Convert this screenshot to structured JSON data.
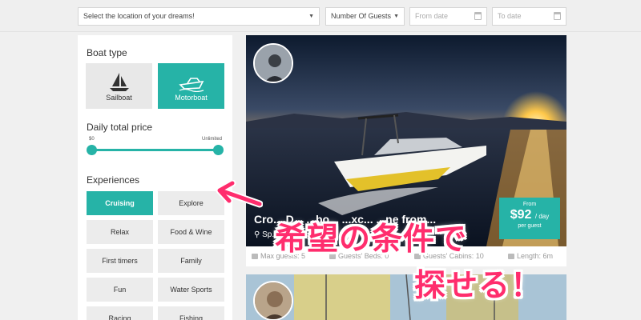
{
  "search": {
    "location_placeholder": "Select the location of your dreams!",
    "guests_label": "Number Of Guests",
    "from_placeholder": "From date",
    "to_placeholder": "To date"
  },
  "filters": {
    "boat_type_title": "Boat type",
    "boat_types": [
      {
        "label": "Sailboat",
        "selected": false,
        "icon": "sailboat-icon"
      },
      {
        "label": "Motorboat",
        "selected": true,
        "icon": "motorboat-icon"
      }
    ],
    "price_title": "Daily total price",
    "price_min": "$0",
    "price_max": "Unlimited",
    "experiences_title": "Experiences",
    "experiences": [
      {
        "label": "Cruising",
        "active": true
      },
      {
        "label": "Explore",
        "active": false
      },
      {
        "label": "Relax",
        "active": false
      },
      {
        "label": "Food & Wine",
        "active": false
      },
      {
        "label": "First timers",
        "active": false
      },
      {
        "label": "Family",
        "active": false
      },
      {
        "label": "Fun",
        "active": false
      },
      {
        "label": "Water Sports",
        "active": false
      },
      {
        "label": "Racing",
        "active": false
      },
      {
        "label": "Fishing",
        "active": false
      }
    ]
  },
  "listing": {
    "title": "Cro... D... ...bo... ...xc... ...ne from...",
    "location": "Sp...",
    "price": {
      "from": "From",
      "amount": "$92",
      "unit": "/ day",
      "per": "per guest"
    },
    "specs": {
      "max_guests": "Max guests: 5",
      "beds": "Guests' Beds: 0",
      "cabins": "Guests' Cabins: 10",
      "length": "Length: 6m"
    }
  },
  "annotation": {
    "line1": "希望の条件で",
    "line2": "探せる！"
  },
  "colors": {
    "accent": "#26b3a7",
    "annotation": "#ff2d6d"
  }
}
